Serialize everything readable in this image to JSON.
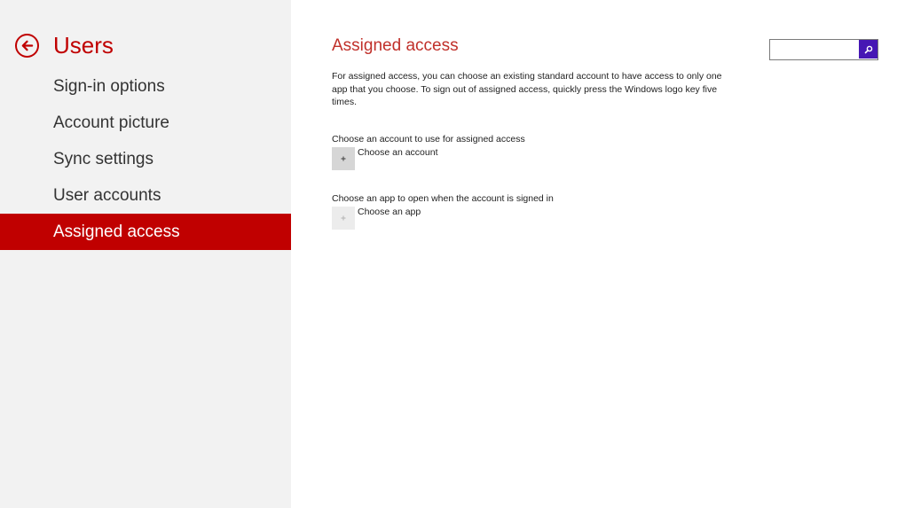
{
  "sidebar": {
    "title": "Users",
    "back_icon": "back-arrow-icon",
    "items": [
      {
        "label": "Sign-in options",
        "active": false
      },
      {
        "label": "Account picture",
        "active": false
      },
      {
        "label": "Sync settings",
        "active": false
      },
      {
        "label": "User accounts",
        "active": false
      },
      {
        "label": "Assigned access",
        "active": true
      }
    ]
  },
  "main": {
    "title": "Assigned access",
    "description": "For assigned access, you can choose an existing standard account to have access to only one app that you choose.  To sign out of assigned access, quickly press the Windows logo key five times.",
    "account_section": {
      "label": "Choose an account to use for assigned access",
      "picker_label": "Choose an account",
      "picker_icon": "plus-icon",
      "enabled": true
    },
    "app_section": {
      "label": "Choose an app to open when the account is signed in",
      "picker_label": "Choose an app",
      "picker_icon": "plus-icon",
      "enabled": false
    }
  },
  "search": {
    "value": "",
    "placeholder": "",
    "icon": "search-icon"
  },
  "colors": {
    "accent": "#c00000",
    "title": "#c0302a",
    "sidebar_bg": "#f2f2f2",
    "search_button": "#4617b4"
  }
}
